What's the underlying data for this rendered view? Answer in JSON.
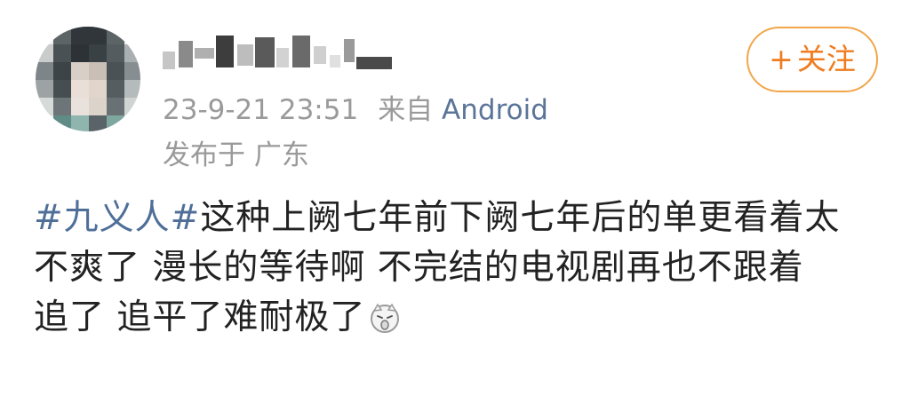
{
  "post": {
    "username": "",
    "timestamp": "23-9-21 23:51",
    "source_prefix": "来自",
    "source": "Android",
    "location": "发布于 广东",
    "follow_button": {
      "plus": "+",
      "label": "关注"
    },
    "content": {
      "topic": "#九义人#",
      "line1_rest": "这种上阙七年前下阙七年后的单更看着太",
      "line2": "不爽了 漫长的等待啊 不完结的电视剧再也不跟着",
      "line3": "追了 追平了难耐极了",
      "emoji": "sad-face-emoji"
    }
  },
  "colors": {
    "meta_text": "#9a9a9a",
    "source_link": "#5b7599",
    "topic_link": "#4f6f98",
    "follow_accent": "#ef7c1f",
    "follow_border": "#f2a64a",
    "body_text": "#222222"
  },
  "icons": {
    "avatar": "avatar-pixelated",
    "emoji": "sad-face-emoji"
  }
}
